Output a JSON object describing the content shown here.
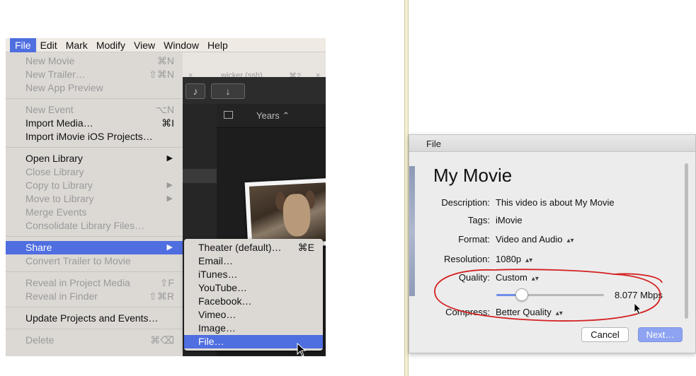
{
  "menubar": {
    "items": [
      "File",
      "Edit",
      "Mark",
      "Modify",
      "View",
      "Window",
      "Help"
    ],
    "active": "File"
  },
  "background": {
    "tab_label": "wicker (ssh)",
    "tab_shortcut": "⌘2",
    "years_label": "Years ⌃",
    "download_icon": "↓"
  },
  "file_menu": {
    "items": [
      {
        "label": "New Movie",
        "shortcut": "⌘N"
      },
      {
        "label": "New Trailer…",
        "shortcut": "⇧⌘N"
      },
      {
        "label": "New App Preview",
        "shortcut": ""
      },
      {
        "label": "New Event",
        "shortcut": "⌥N"
      },
      {
        "label": "Import Media…",
        "shortcut": "⌘I"
      },
      {
        "label": "Import iMovie iOS Projects…",
        "shortcut": ""
      },
      {
        "label": "Open Library",
        "shortcut": ""
      },
      {
        "label": "Close Library",
        "shortcut": ""
      },
      {
        "label": "Copy to Library",
        "shortcut": ""
      },
      {
        "label": "Move to Library",
        "shortcut": ""
      },
      {
        "label": "Merge Events",
        "shortcut": ""
      },
      {
        "label": "Consolidate Library Files…",
        "shortcut": ""
      },
      {
        "label": "Share",
        "shortcut": ""
      },
      {
        "label": "Convert Trailer to Movie",
        "shortcut": ""
      },
      {
        "label": "Reveal in Project Media",
        "shortcut": "⇧F"
      },
      {
        "label": "Reveal in Finder",
        "shortcut": "⇧⌘R"
      },
      {
        "label": "Update Projects and Events…",
        "shortcut": ""
      },
      {
        "label": "Delete",
        "shortcut": "⌘⌫"
      }
    ]
  },
  "share_submenu": {
    "items": [
      {
        "label": "Theater (default)…",
        "shortcut": "⌘E"
      },
      {
        "label": "Email…",
        "shortcut": ""
      },
      {
        "label": "iTunes…",
        "shortcut": ""
      },
      {
        "label": "YouTube…",
        "shortcut": ""
      },
      {
        "label": "Facebook…",
        "shortcut": ""
      },
      {
        "label": "Vimeo…",
        "shortcut": ""
      },
      {
        "label": "Image…",
        "shortcut": ""
      },
      {
        "label": "File…",
        "shortcut": ""
      }
    ],
    "selected": "File…"
  },
  "dialog": {
    "title": "File",
    "movie_title": "My Movie",
    "fields": {
      "description": {
        "label": "Description:",
        "value": "This video is about My Movie"
      },
      "tags": {
        "label": "Tags:",
        "value": "iMovie"
      },
      "format": {
        "label": "Format:",
        "value": "Video and Audio"
      },
      "resolution": {
        "label": "Resolution:",
        "value": "1080p"
      },
      "quality": {
        "label": "Quality:",
        "value": "Custom"
      },
      "compress": {
        "label": "Compress:",
        "value": "Better Quality"
      }
    },
    "bitrate": "8.077 Mbps",
    "bitrate_slider_fraction": 0.24,
    "cancel_label": "Cancel",
    "next_label": "Next…",
    "annotation_color": "#d42020",
    "accent_color": "#4f6ee0"
  }
}
